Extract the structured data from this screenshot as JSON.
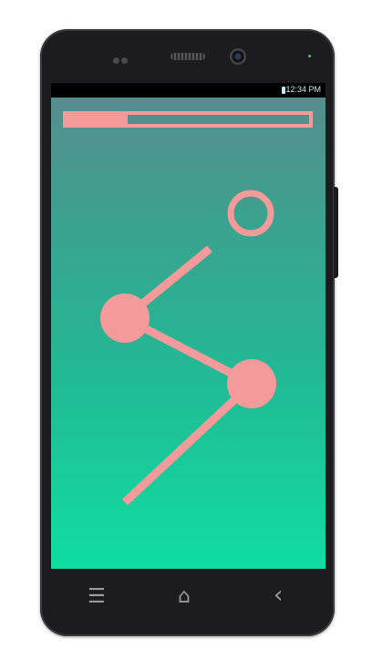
{
  "status_bar": {
    "time": "12:34 PM",
    "battery_icon": "battery-icon"
  },
  "game": {
    "progress_fraction": 0.25,
    "accent_color": "#f49a9a",
    "background_top": "#5a8a8e",
    "background_bottom": "#0fdea0"
  },
  "nav": {
    "menu_icon": "☰",
    "home_icon": "⌂",
    "back_icon": "‹"
  }
}
